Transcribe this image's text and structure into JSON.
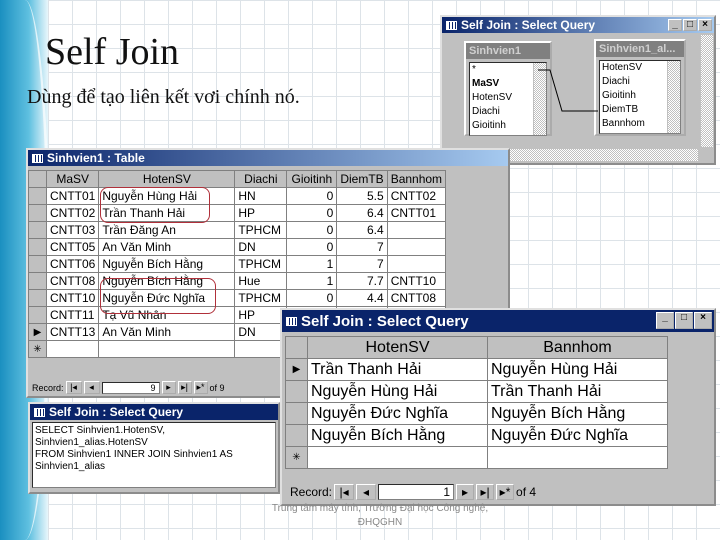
{
  "slide": {
    "title": "Self Join",
    "subtitle": "Dùng để tạo liên kết vơi chính nó.",
    "footer": "Trung tâm máy tính, Trường Đại học Công nghệ, ĐHQGHN"
  },
  "design_window": {
    "title": "Self Join : Select Query",
    "tables": [
      {
        "name": "Sinhvien1",
        "fields": [
          "*",
          "MaSV",
          "HotenSV",
          "Diachi",
          "Gioitinh"
        ]
      },
      {
        "name": "Sinhvien1_al...",
        "fields": [
          "HotenSV",
          "Diachi",
          "Gioitinh",
          "DiemTB",
          "Bannhom"
        ]
      }
    ]
  },
  "table_window": {
    "title": "Sinhvien1 : Table",
    "columns": [
      "MaSV",
      "HotenSV",
      "Diachi",
      "Gioitinh",
      "DiemTB",
      "Bannhom"
    ],
    "rows": [
      [
        "CNTT01",
        "Nguyễn Hùng Hải",
        "HN",
        "0",
        "5.5",
        "CNTT02"
      ],
      [
        "CNTT02",
        "Trần Thanh Hải",
        "HP",
        "0",
        "6.4",
        "CNTT01"
      ],
      [
        "CNTT03",
        "Trần Đăng An",
        "TPHCM",
        "0",
        "6.4",
        ""
      ],
      [
        "CNTT05",
        "An Văn Minh",
        "DN",
        "0",
        "7",
        ""
      ],
      [
        "CNTT06",
        "Nguyễn Bích Hằng",
        "TPHCM",
        "1",
        "7",
        ""
      ],
      [
        "CNTT08",
        "Nguyễn Bích Hằng",
        "Hue",
        "1",
        "7.7",
        "CNTT10"
      ],
      [
        "CNTT10",
        "Nguyễn Đức Nghĩa",
        "TPHCM",
        "0",
        "4.4",
        "CNTT08"
      ],
      [
        "CNTT11",
        "Tạ Vũ Nhân",
        "HP",
        "0",
        "",
        ""
      ],
      [
        "CNTT13",
        "An Văn Minh",
        "DN",
        "0",
        "",
        ""
      ]
    ],
    "record_label": "Record:",
    "record_current": "9",
    "record_total": "of 9"
  },
  "sql_window": {
    "title": "Self Join : Select Query",
    "lines": [
      "SELECT Sinhvien1.HotenSV, Sinhvien1_alias.HotenSV",
      "FROM Sinhvien1 INNER JOIN Sinhvien1 AS Sinhvien1_alias"
    ]
  },
  "result_window": {
    "title": "Self Join : Select Query",
    "columns": [
      "HotenSV",
      "Bannhom"
    ],
    "rows": [
      [
        "Trần Thanh Hải",
        "Nguyễn Hùng Hải"
      ],
      [
        "Nguyễn Hùng Hải",
        "Trần Thanh Hải"
      ],
      [
        "Nguyễn Đức Nghĩa",
        "Nguyễn Bích Hằng"
      ],
      [
        "Nguyễn Bích Hằng",
        "Nguyễn Đức Nghĩa"
      ]
    ],
    "record_label": "Record:",
    "record_current": "1",
    "record_total": "of 4"
  },
  "colors": {
    "titlebar_active": "#0a246a",
    "highlight_circle": "#b0303a",
    "window_face": "#c0c0c0"
  }
}
